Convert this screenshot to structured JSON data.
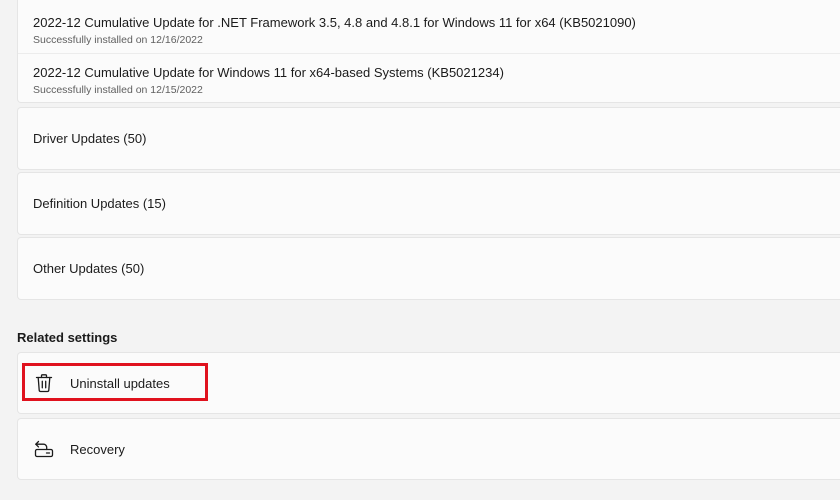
{
  "update_history": {
    "quality_updates": [
      {
        "title": "2022-12 Cumulative Update for .NET Framework 3.5, 4.8 and 4.8.1 for Windows 11 for x64 (KB5021090)",
        "status": "Successfully installed on 12/16/2022"
      },
      {
        "title": "2022-12 Cumulative Update for Windows 11 for x64-based Systems (KB5021234)",
        "status": "Successfully installed on 12/15/2022"
      }
    ],
    "categories": [
      {
        "label": "Driver Updates (50)"
      },
      {
        "label": "Definition Updates (15)"
      },
      {
        "label": "Other Updates (50)"
      }
    ]
  },
  "related_settings": {
    "header": "Related settings",
    "items": [
      {
        "label": "Uninstall updates",
        "icon": "trash-icon"
      },
      {
        "label": "Recovery",
        "icon": "recovery-icon"
      }
    ]
  },
  "colors": {
    "background": "#f3f3f3",
    "card": "#fbfbfb",
    "highlight": "#e0121e"
  }
}
